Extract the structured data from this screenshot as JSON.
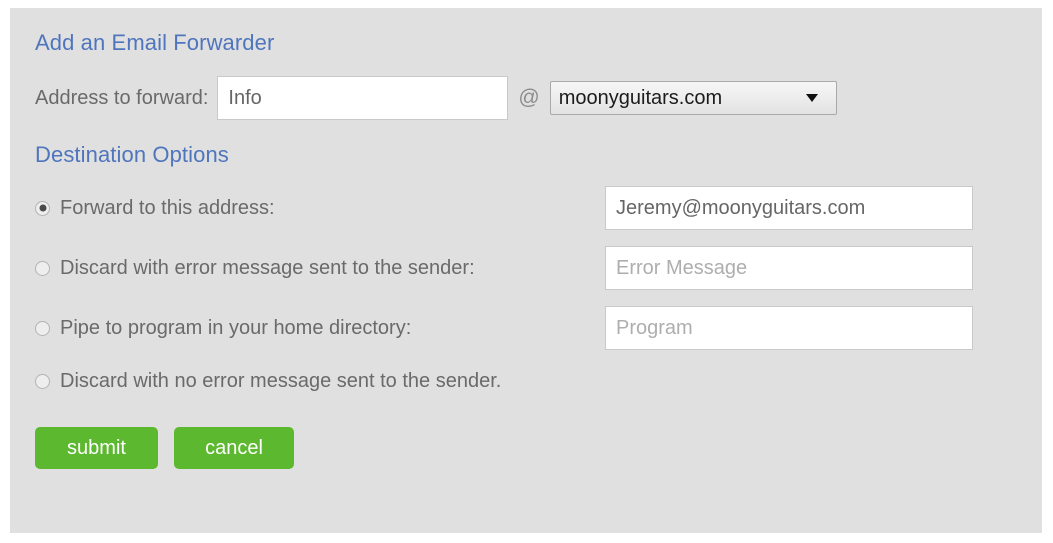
{
  "panel": {
    "background_color": "#e0e0e0"
  },
  "form": {
    "title": "Add an Email Forwarder",
    "accent_color": "#4f75bd",
    "address": {
      "label": "Address to forward:",
      "input_value": "Info",
      "input_placeholder": "",
      "at_symbol": "@",
      "domain_selected": "moonyguitars.com",
      "domain_options": [
        "moonyguitars.com"
      ]
    },
    "destination": {
      "title": "Destination Options",
      "options": [
        {
          "label": "Forward to this address:",
          "selected": true,
          "input_value": "Jeremy@moonyguitars.com",
          "input_placeholder": "",
          "has_input": true
        },
        {
          "label": "Discard with error message sent to the sender:",
          "selected": false,
          "input_value": "",
          "input_placeholder": "Error Message",
          "has_input": true
        },
        {
          "label": "Pipe to program in your home directory:",
          "selected": false,
          "input_value": "",
          "input_placeholder": "Program",
          "has_input": true
        },
        {
          "label": "Discard with no error message sent to the sender.",
          "selected": false,
          "input_value": "",
          "input_placeholder": "",
          "has_input": false
        }
      ]
    },
    "buttons": {
      "submit_label": "submit",
      "cancel_label": "cancel",
      "button_color": "#5cb82f"
    }
  }
}
